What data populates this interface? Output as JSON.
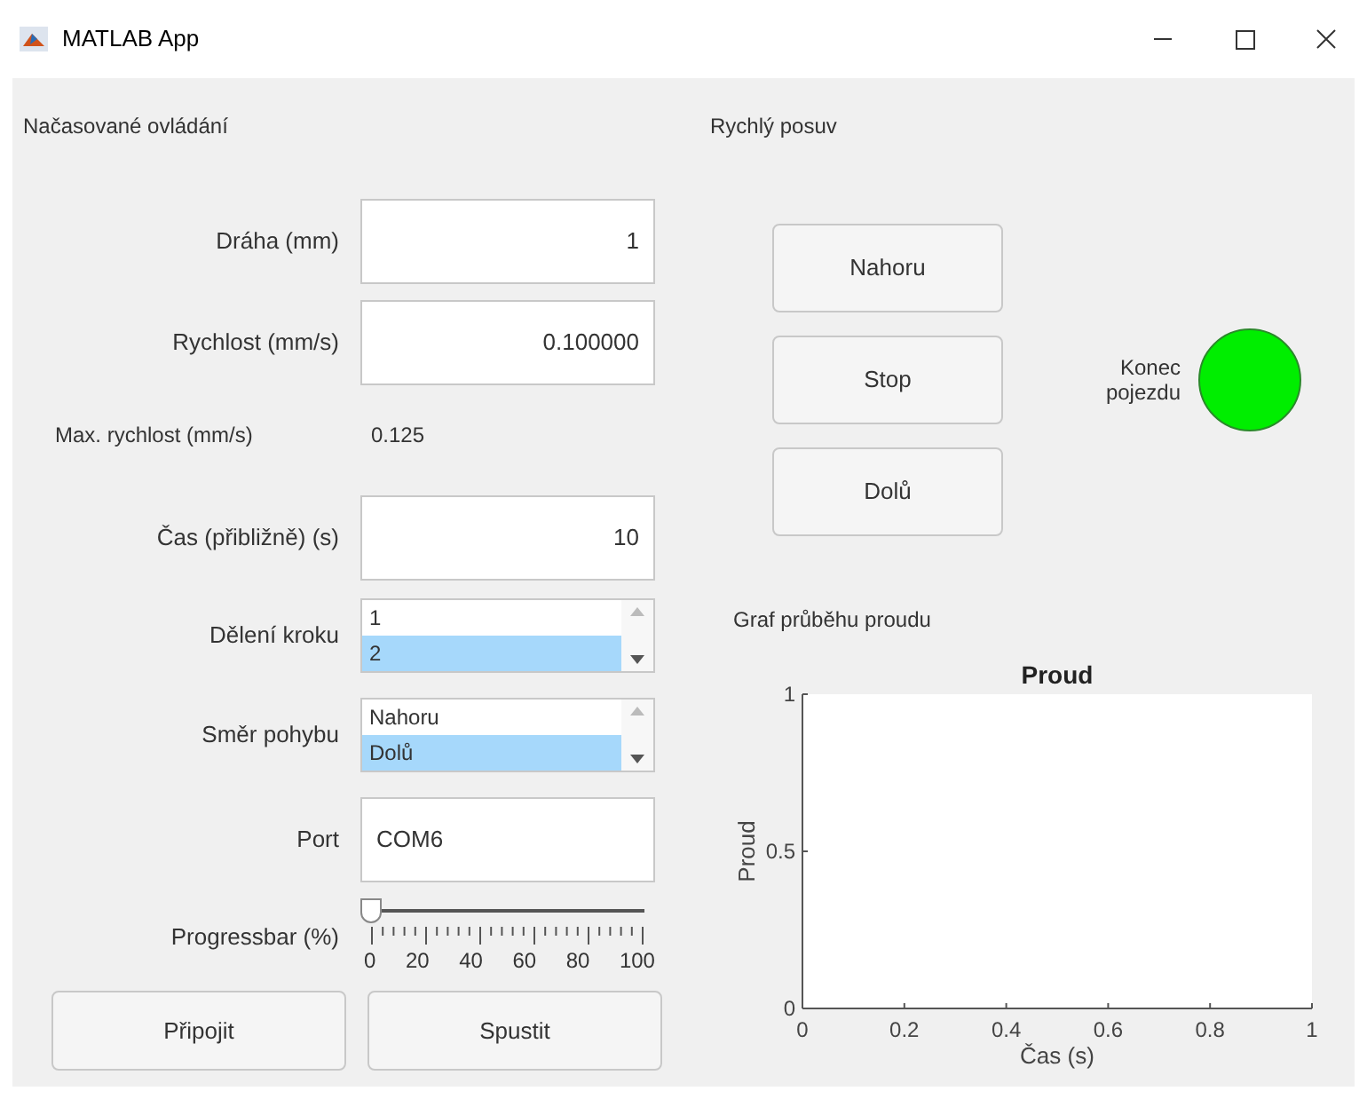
{
  "window": {
    "title": "MATLAB App"
  },
  "left": {
    "title": "Načasované ovládání",
    "fields": [
      {
        "label": "Dráha (mm)",
        "value": "1"
      },
      {
        "label": "Rychlost (mm/s)",
        "value": "0.100000"
      }
    ],
    "max_speed": {
      "label": "Max. rychlost (mm/s)",
      "value": "0.125"
    },
    "time_field": {
      "label": "Čas (přibližně) (s)",
      "value": "10"
    },
    "listboxes": [
      {
        "label": "Dělení kroku",
        "items": [
          {
            "text": "1",
            "selected": false
          },
          {
            "text": "2",
            "selected": true
          }
        ]
      },
      {
        "label": "Směr pohybu",
        "items": [
          {
            "text": "Nahoru",
            "selected": false
          },
          {
            "text": "Dolů",
            "selected": true
          }
        ]
      }
    ],
    "port": {
      "label": "Port",
      "value": "COM6"
    },
    "slider": {
      "label": "Progressbar (%)",
      "level": 0,
      "tick_labels": [
        "0",
        "20",
        "40",
        "60",
        "80",
        "100"
      ]
    },
    "buttons": [
      "Připojit",
      "Spustit"
    ]
  },
  "right": {
    "title": "Rychlý posuv",
    "buttons": [
      "Nahoru",
      "Stop",
      "Dolů"
    ],
    "lamp": {
      "label": "Konec pojezdu",
      "color": "#00ee00"
    },
    "graph": {
      "label": "Graf průběhu proudu",
      "chart_data": {
        "type": "line",
        "title": "Proud",
        "xlabel": "Čas (s)",
        "ylabel": "Proud",
        "xlim": [
          0,
          1
        ],
        "ylim": [
          0,
          1
        ],
        "xticks": [
          0,
          0.2,
          0.4,
          0.6,
          0.8,
          1
        ],
        "yticks": [
          0,
          0.5,
          1
        ]
      }
    }
  }
}
